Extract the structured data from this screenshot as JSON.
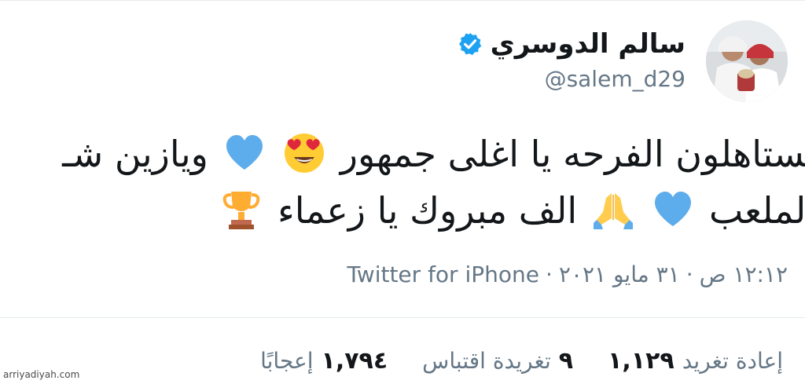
{
  "tweet": {
    "author": {
      "display_name": "سالم الدوسري",
      "username": "@salem_d29",
      "verified": true
    },
    "text_line_1": {
      "part_a": "تستاهلون الفرحه يا اغلى جمهور",
      "part_b": "ويازين شـ"
    },
    "text_line_2": {
      "part_a": "الملعب",
      "part_b": "الف مبروك يا زعماء"
    },
    "emojis": [
      "smiling-face-heart-eyes-icon",
      "blue-heart-icon",
      "folded-hands-icon",
      "trophy-icon"
    ],
    "meta": {
      "time": "١٢:١٢ ص",
      "separator": "·",
      "date": "٣١ مايو ٢٠٢١",
      "source": "Twitter for iPhone"
    },
    "stats": {
      "retweets": {
        "count": "١,١٢٩",
        "label": "إعادة تغريد"
      },
      "quotes": {
        "count": "٩",
        "label": "تغريدة اقتباس"
      },
      "likes": {
        "count": "١,٧٩٤",
        "label": "إعجابًا"
      }
    }
  },
  "watermark": "arriyadiyah.com",
  "colors": {
    "text_primary": "#14171a",
    "text_secondary": "#657786",
    "verified_blue": "#1da1f2",
    "heart_blue": "#5dadec",
    "divider": "#e6ecf0"
  }
}
